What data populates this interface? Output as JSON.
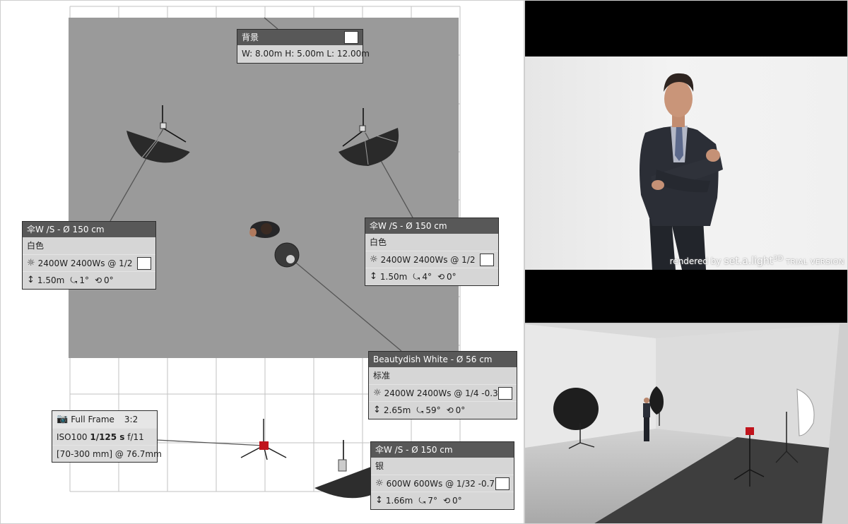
{
  "floorplan": {
    "background": {
      "label": "背景",
      "dims": "W: 8.00m H: 5.00m L: 12.00m"
    },
    "lights": [
      {
        "title": "伞W /S - Ø 150 cm",
        "modifier": "白色",
        "power": "2400W 2400Ws @ 1/2",
        "height": "1.50m",
        "tilt": "1°",
        "rotation": "0°"
      },
      {
        "title": "伞W /S - Ø 150 cm",
        "modifier": "白色",
        "power": "2400W 2400Ws @ 1/2",
        "height": "1.50m",
        "tilt": "4°",
        "rotation": "0°"
      },
      {
        "title": "Beautydish White - Ø 56 cm",
        "modifier": "标准",
        "power": "2400W 2400Ws @ 1/4 -0.3",
        "height": "2.65m",
        "tilt": "59°",
        "rotation": "0°"
      },
      {
        "title": "伞W /S - Ø 150 cm",
        "modifier": "银",
        "power": "600W 600Ws @ 1/32 -0.7",
        "height": "1.66m",
        "tilt": "7°",
        "rotation": "0°"
      }
    ],
    "camera": {
      "sensor": "Full Frame",
      "ratio": "3:2",
      "iso": "ISO100",
      "shutter": "1/125 s",
      "aperture": "f/11",
      "lens": "[70-300 mm] @ 76.7mm"
    }
  },
  "render": {
    "watermark_prefix": "rendered by",
    "watermark_brand": "set.a.light",
    "watermark_3d": "3D",
    "watermark_trial": "TRIAL VERSION"
  },
  "icons": {
    "power": "sun-icon",
    "height": "height-arrows-icon",
    "tilt": "tilt-icon",
    "rotation": "rotation-icon",
    "camera": "camera-icon"
  },
  "colors": {
    "panel_bg": "#d6d6d6",
    "panel_header": "#585858",
    "backdrop": "#9a9a9a",
    "camera_red": "#c0141c"
  }
}
